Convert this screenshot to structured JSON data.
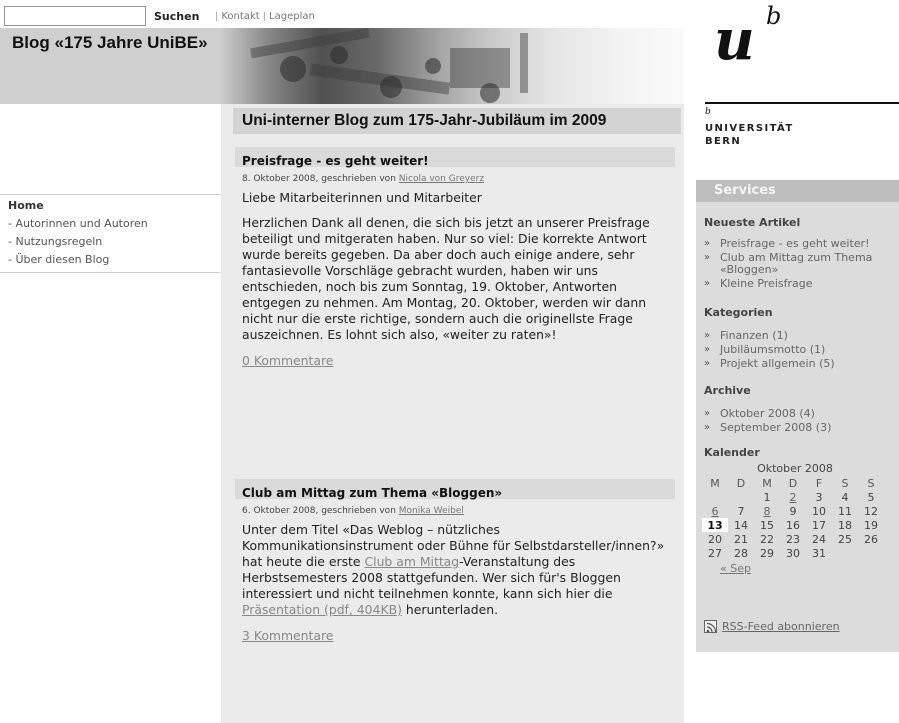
{
  "search": {
    "placeholder": "",
    "button_label": "Suchen"
  },
  "toplinks": {
    "sep": "|",
    "contact": "Kontakt",
    "sep2": "|",
    "map": "Lageplan"
  },
  "blog_title": "Blog «175 Jahre UniBE»",
  "logo": {
    "u": "u",
    "b": "b",
    "b_small": "b",
    "line1": "UNIVERSITÄT",
    "line2": "BERN"
  },
  "nav": {
    "home": "Home",
    "items": [
      "- Autorinnen und Autoren",
      "- Nutzungsregeln",
      "- Über diesen Blog"
    ]
  },
  "main": {
    "title": "Uni-interner Blog zum 175-Jahr-Jubiläum im 2009",
    "posts": [
      {
        "title": "Preisfrage - es geht weiter!",
        "meta_prefix": "8. Oktober 2008, geschrieben von",
        "author": "Nicola von Greyerz",
        "p1": "Liebe Mitarbeiterinnen und Mitarbeiter",
        "p2": "Herzlichen Dank all denen, die sich bis jetzt an unserer Preisfrage beteiligt und mitgeraten haben. Nur so viel: Die korrekte Antwort wurde bereits gegeben. Da aber doch auch einige andere, sehr fantasievolle Vorschläge gebracht wurden, haben wir uns entschieden, noch bis zum Sonntag, 19. Oktober, Antworten entgegen zu nehmen. Am Montag, 20. Oktober, werden wir dann nicht nur die erste richtige, sondern auch die originellste Frage auszeichnen. Es lohnt sich also, «weiter zu raten»!",
        "comments": "0 Kommentare"
      },
      {
        "title": "Club am Mittag zum Thema «Bloggen»",
        "meta_prefix": "6. Oktober 2008, geschrieben von",
        "author": "Monika Weibel",
        "p1_a": "Unter dem Titel «Das Weblog – nützliches Kommunikationsinstrument oder Bühne für Selbstdarsteller/innen?» hat heute die erste",
        "p1_link": "Club am Mittag",
        "p1_b": "-Veranstaltung des Herbstsemesters 2008 stattgefunden. Wer sich für's Bloggen interessiert und nicht teilnehmen konnte, kann sich hier die",
        "p1_link2": "Präsentation (pdf, 404KB)",
        "p1_c": "herunterladen.",
        "comments": "3 Kommentare"
      }
    ]
  },
  "sidebar": {
    "title": "Services",
    "recent_heading": "Neueste Artikel",
    "recent": [
      "Preisfrage - es geht weiter!",
      "Club am Mittag zum Thema «Bloggen»",
      "Kleine Preisfrage"
    ],
    "cat_heading": "Kategorien",
    "categories": [
      "Finanzen (1)",
      "Jubiläumsmotto (1)",
      "Projekt allgemein (5)"
    ],
    "arch_heading": "Archive",
    "archives": [
      "Oktober 2008 (4)",
      "September 2008 (3)"
    ],
    "cal_heading": "Kalender",
    "calendar": {
      "caption": "Oktober 2008",
      "weekdays": [
        "M",
        "D",
        "M",
        "D",
        "F",
        "S",
        "S"
      ],
      "rows": [
        [
          "",
          "",
          "1",
          "2",
          "3",
          "4",
          "5"
        ],
        [
          "6",
          "7",
          "8",
          "9",
          "10",
          "11",
          "12"
        ],
        [
          "13",
          "14",
          "15",
          "16",
          "17",
          "18",
          "19"
        ],
        [
          "20",
          "21",
          "22",
          "23",
          "24",
          "25",
          "26"
        ],
        [
          "27",
          "28",
          "29",
          "30",
          "31",
          "",
          ""
        ]
      ],
      "linked_days": [
        "2",
        "6",
        "8"
      ],
      "today": "13",
      "prev": "« Sep"
    },
    "rss": "RSS-Feed abonnieren"
  },
  "colors": {
    "main_bg": "#ebebeb",
    "sidebar_bg": "#dcdcdc",
    "header_band": "#cfcfcf",
    "link": "#888888"
  }
}
